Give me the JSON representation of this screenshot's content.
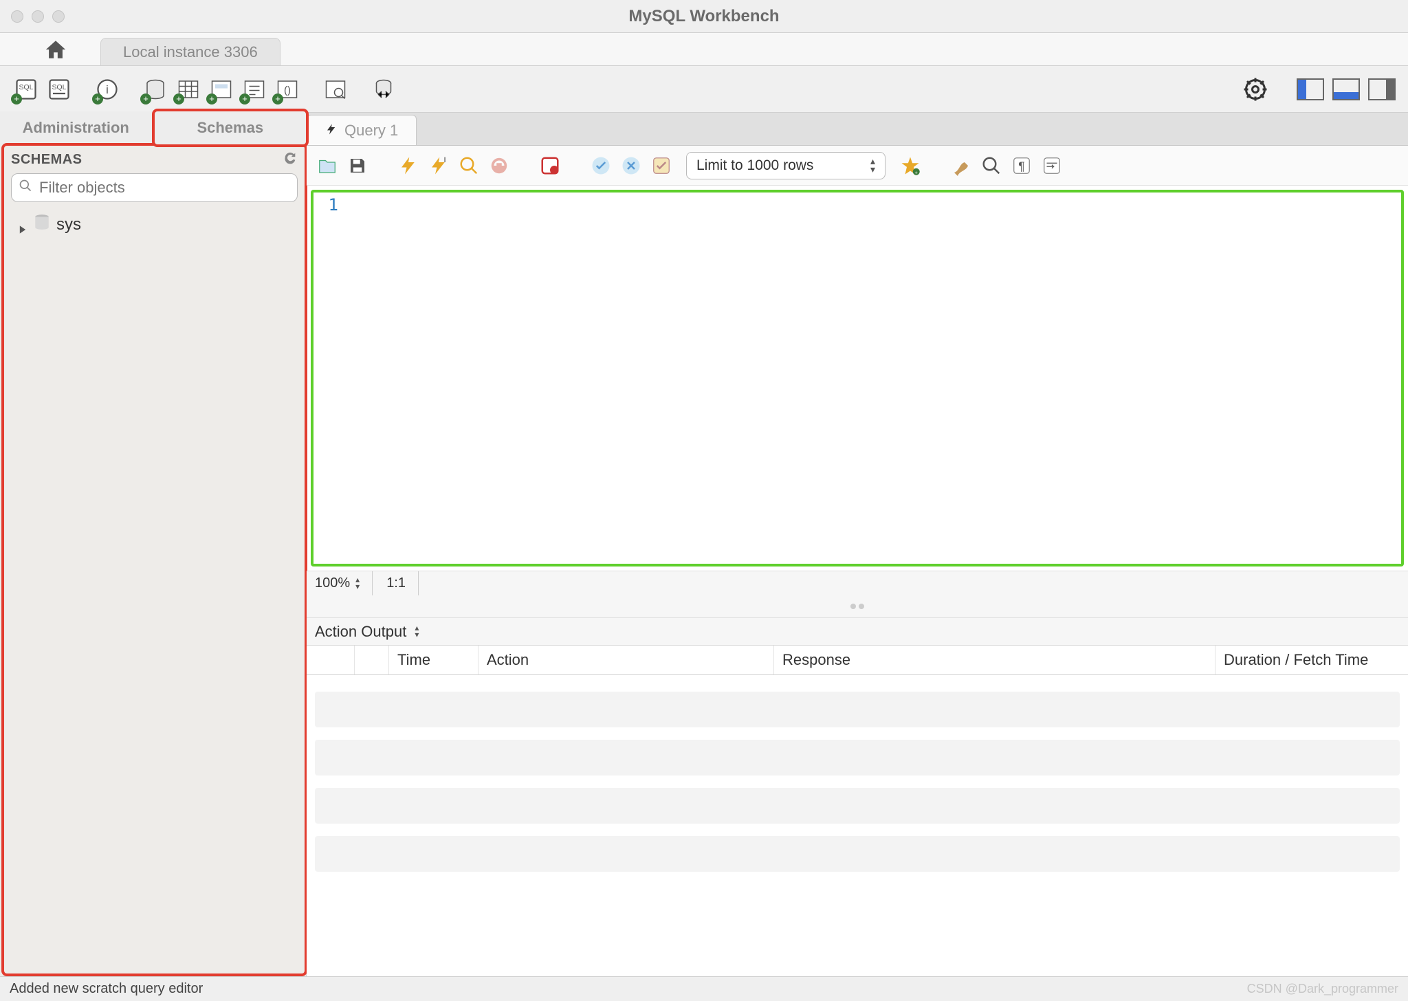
{
  "window": {
    "title": "MySQL Workbench"
  },
  "conn_tab": {
    "label": "Local instance 3306"
  },
  "sidebar": {
    "tabs": {
      "admin": "Administration",
      "schemas": "Schemas"
    },
    "header": "SCHEMAS",
    "filter_placeholder": "Filter objects",
    "tree": [
      {
        "label": "sys"
      }
    ]
  },
  "query": {
    "tab_label": "Query 1",
    "limit_label": "Limit to 1000 rows",
    "line_number": "1",
    "zoom": "100%",
    "ratio": "1:1"
  },
  "output": {
    "selector": "Action Output",
    "cols": {
      "time": "Time",
      "action": "Action",
      "response": "Response",
      "duration": "Duration / Fetch Time"
    }
  },
  "status": {
    "message": "Added new scratch query editor",
    "watermark": "CSDN @Dark_programmer"
  }
}
